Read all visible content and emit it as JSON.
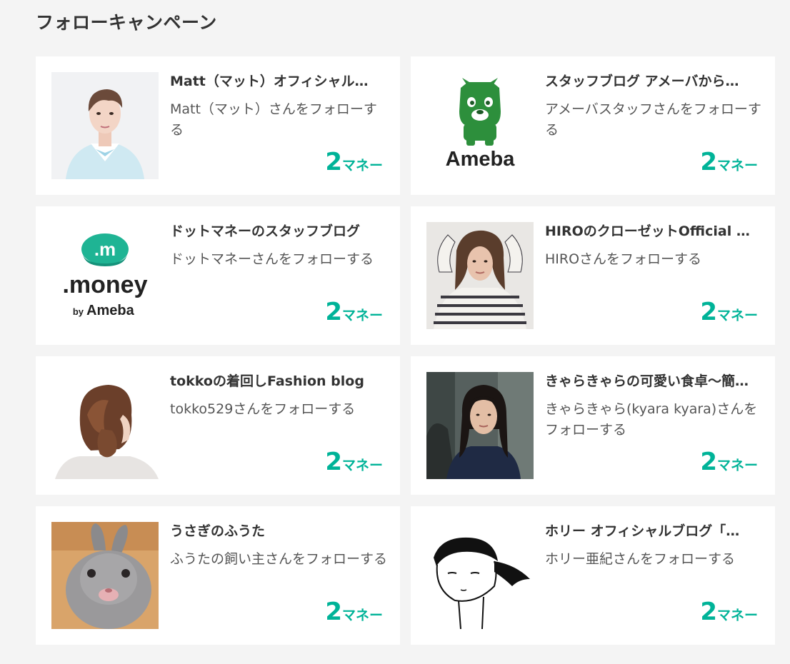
{
  "page": {
    "title": "フォローキャンペーン"
  },
  "colors": {
    "accent": "#00b398",
    "ameba_green": "#2d8f3c",
    "money_teal": "#1fb494"
  },
  "campaigns": [
    {
      "title": "Matt（マット）オフィシャル…",
      "description": "Matt（マット）さんをフォローする",
      "reward_amount": "2",
      "reward_unit": "マネー",
      "thumbnail": "matt-portrait"
    },
    {
      "title": "スタッフブログ アメーバから…",
      "description": "アメーバスタッフさんをフォローする",
      "reward_amount": "2",
      "reward_unit": "マネー",
      "thumbnail": "ameba-logo",
      "logo_text": "Ameba"
    },
    {
      "title": "ドットマネーのスタッフブログ",
      "description": "ドットマネーさんをフォローする",
      "reward_amount": "2",
      "reward_unit": "マネー",
      "thumbnail": "dotmoney-logo",
      "logo_mark": ".m",
      "logo_text": ".money",
      "logo_by": "by",
      "logo_sub": "Ameba"
    },
    {
      "title": "HIROのクローゼットOfficial …",
      "description": "HIROさんをフォローする",
      "reward_amount": "2",
      "reward_unit": "マネー",
      "thumbnail": "hiro-portrait"
    },
    {
      "title": "tokkoの着回しFashion blog",
      "description": "tokko529さんをフォローする",
      "reward_amount": "2",
      "reward_unit": "マネー",
      "thumbnail": "tokko-hair-photo"
    },
    {
      "title": "きゃらきゃらの可愛い食卓～簡…",
      "description": "きゃらきゃら(kyara kyara)さんをフォローする",
      "reward_amount": "2",
      "reward_unit": "マネー",
      "thumbnail": "kyara-portrait"
    },
    {
      "title": "うさぎのふうた",
      "description": "ふうたの飼い主さんをフォローする",
      "reward_amount": "2",
      "reward_unit": "マネー",
      "thumbnail": "rabbit-photo"
    },
    {
      "title": "ホリー オフィシャルブログ「…",
      "description": "ホリー亜紀さんをフォローする",
      "reward_amount": "2",
      "reward_unit": "マネー",
      "thumbnail": "holly-illustration"
    }
  ]
}
